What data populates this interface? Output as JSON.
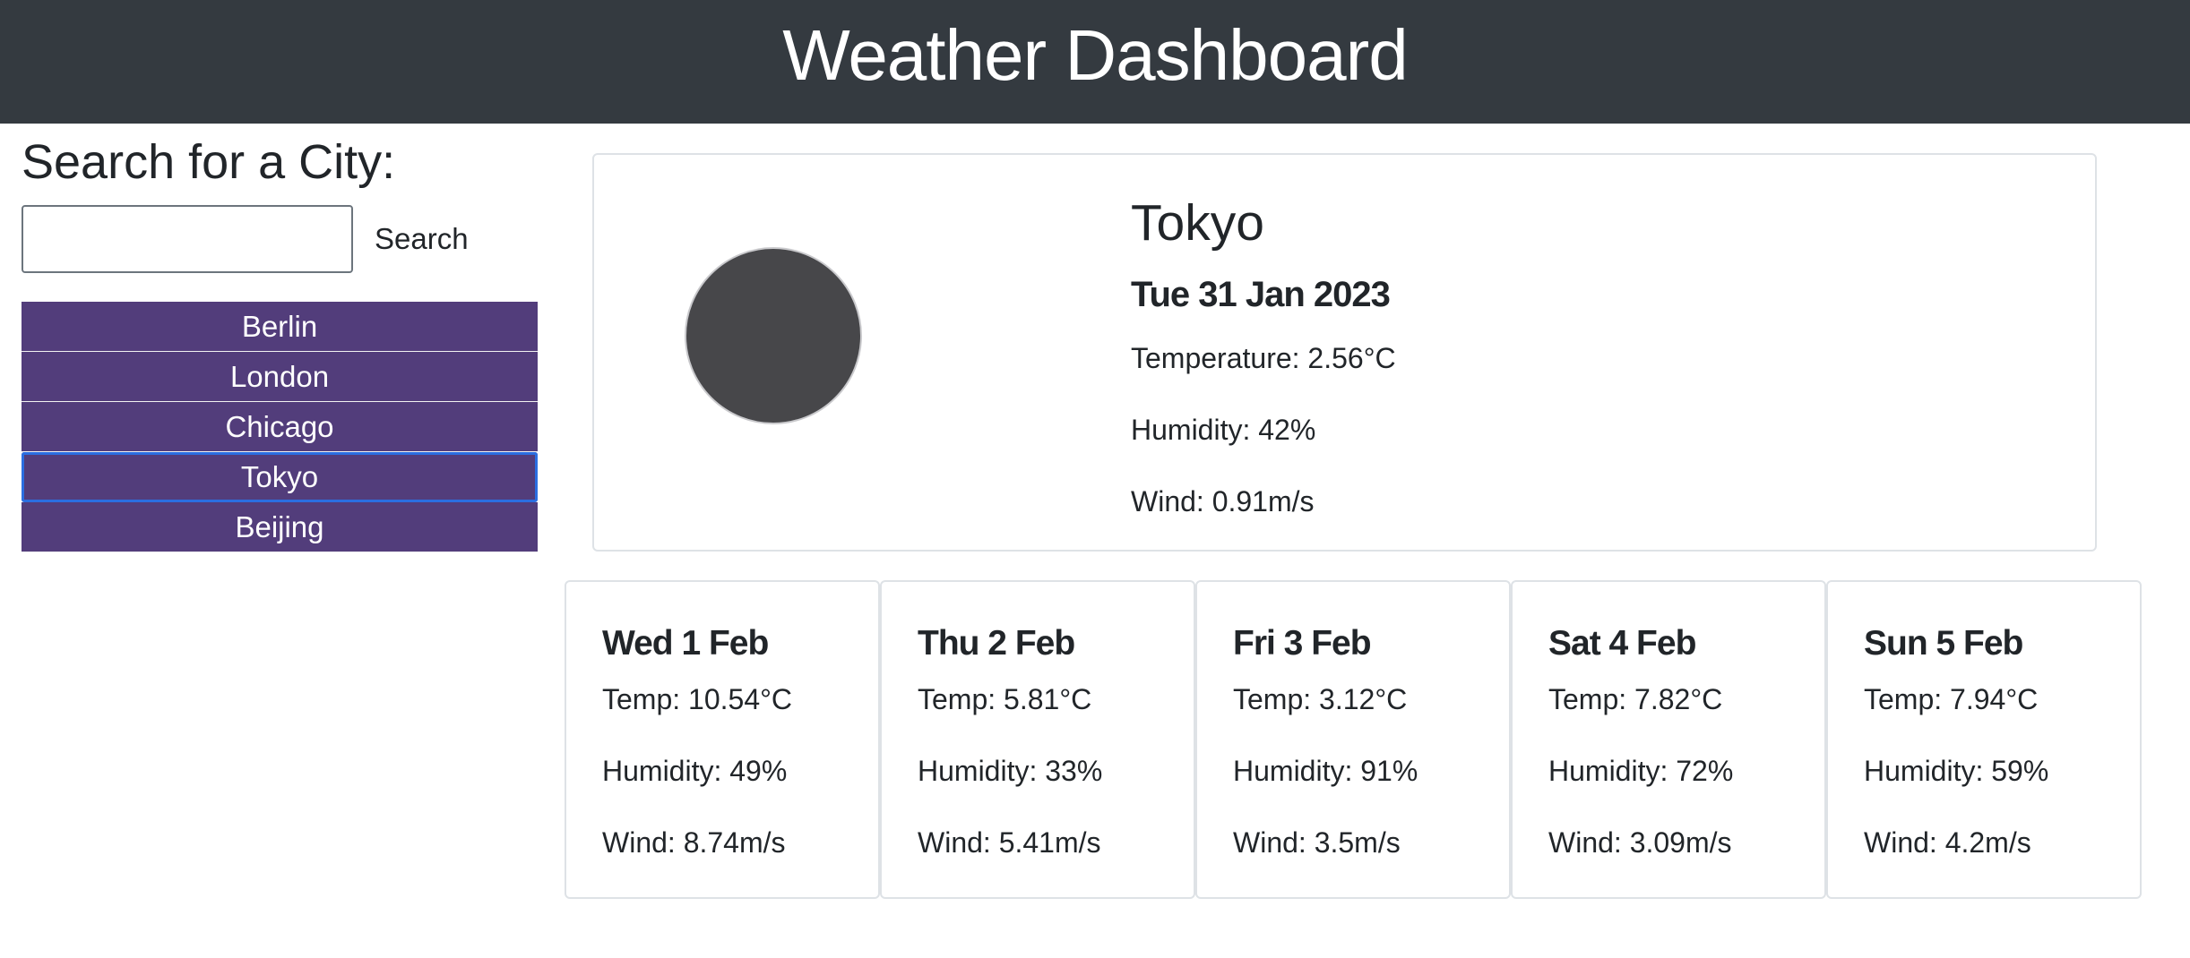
{
  "header": {
    "title": "Weather Dashboard"
  },
  "search": {
    "title": "Search for a City:",
    "input_value": "",
    "placeholder": "",
    "button_label": "Search"
  },
  "history": {
    "items": [
      "Berlin",
      "London",
      "Chicago",
      "Tokyo",
      "Beijing"
    ],
    "selected": "Tokyo"
  },
  "current": {
    "city": "Tokyo",
    "date": "Tue 31 Jan 2023",
    "temperature": "Temperature: 2.56°C",
    "humidity": "Humidity: 42%",
    "wind": "Wind: 0.91m/s",
    "icon": "weather-icon-placeholder"
  },
  "forecast": [
    {
      "date": "Wed 1 Feb",
      "temp": "Temp: 10.54°C",
      "humidity": "Humidity: 49%",
      "wind": "Wind: 8.74m/s"
    },
    {
      "date": "Thu 2 Feb",
      "temp": "Temp: 5.81°C",
      "humidity": "Humidity: 33%",
      "wind": "Wind: 5.41m/s"
    },
    {
      "date": "Fri 3 Feb",
      "temp": "Temp: 3.12°C",
      "humidity": "Humidity: 91%",
      "wind": "Wind: 3.5m/s"
    },
    {
      "date": "Sat 4 Feb",
      "temp": "Temp: 7.82°C",
      "humidity": "Humidity: 72%",
      "wind": "Wind: 3.09m/s"
    },
    {
      "date": "Sun 5 Feb",
      "temp": "Temp: 7.94°C",
      "humidity": "Humidity: 59%",
      "wind": "Wind: 4.2m/s"
    }
  ],
  "colors": {
    "header_bg": "#343a40",
    "city_button_bg": "#523d7b",
    "selected_outline": "#2b6ee0"
  }
}
